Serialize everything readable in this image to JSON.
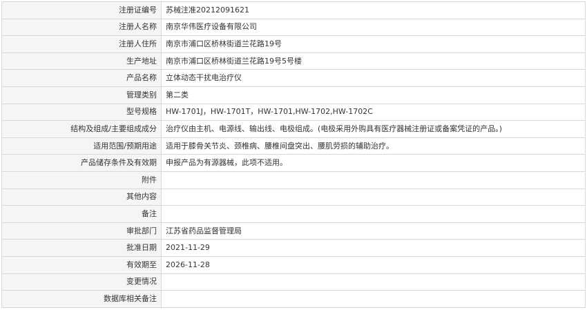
{
  "rows": [
    {
      "label": "注册证编号",
      "value": "苏械注准20212091621"
    },
    {
      "label": "注册人名称",
      "value": "南京华伟医疗设备有限公司"
    },
    {
      "label": "注册人住所",
      "value": "南京市浦口区桥林街道兰花路19号"
    },
    {
      "label": "生产地址",
      "value": "南京市浦口区桥林街道兰花路19号5号楼"
    },
    {
      "label": "产品名称",
      "value": "立体动态干扰电治疗仪"
    },
    {
      "label": "管理类别",
      "value": "第二类"
    },
    {
      "label": "型号规格",
      "value": "HW-1701J，HW-1701T，HW-1701,HW-1702,HW-1702C"
    },
    {
      "label": "结构及组成/主要组成成分",
      "value": "治疗仪由主机、电源线、输出线、电极组成。(电极采用外购具有医疗器械注册证或备案凭证的产品。)"
    },
    {
      "label": "适用范围/预期用途",
      "value": "适用于膝骨关节炎、颈椎病、腰椎间盘突出、腰肌劳损的辅助治疗。"
    },
    {
      "label": "产品储存条件及有效期",
      "value": "申报产品为有源器械，此项不适用。"
    },
    {
      "label": "附件",
      "value": ""
    },
    {
      "label": "其他内容",
      "value": ""
    },
    {
      "label": "备注",
      "value": ""
    },
    {
      "label": "审批部门",
      "value": "江苏省药品监督管理局"
    },
    {
      "label": "批准日期",
      "value": "2021-11-29"
    },
    {
      "label": "有效期至",
      "value": "2026-11-28"
    },
    {
      "label": "变更情况",
      "value": ""
    },
    {
      "label": "数据库相关备注",
      "value": ""
    }
  ]
}
